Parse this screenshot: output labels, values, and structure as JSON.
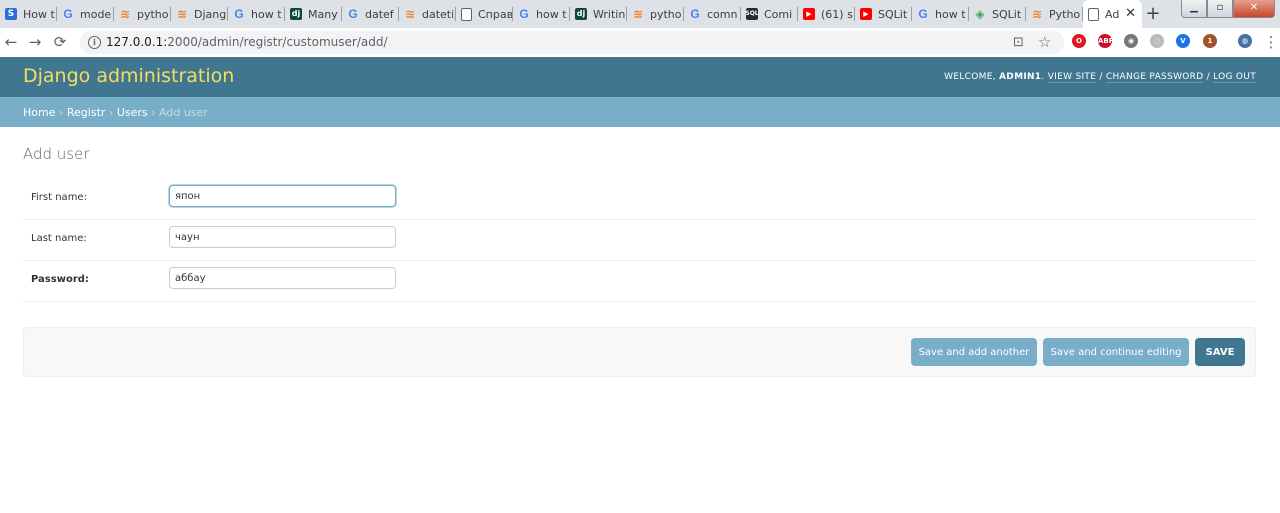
{
  "browser": {
    "tabs": [
      {
        "favicon": "S",
        "kind": "fav-s",
        "label": "How t"
      },
      {
        "favicon": "G",
        "kind": "fav-g",
        "label": "mode"
      },
      {
        "favicon": "≋",
        "kind": "fav-so",
        "label": "pytho"
      },
      {
        "favicon": "≋",
        "kind": "fav-so",
        "label": "Djang"
      },
      {
        "favicon": "G",
        "kind": "fav-g",
        "label": "how t"
      },
      {
        "favicon": "dj",
        "kind": "fav-dj",
        "label": "Many"
      },
      {
        "favicon": "G",
        "kind": "fav-g",
        "label": "datef"
      },
      {
        "favicon": "≋",
        "kind": "fav-so",
        "label": "dateti"
      },
      {
        "favicon": "",
        "kind": "fav-doc",
        "label": "Справ"
      },
      {
        "favicon": "G",
        "kind": "fav-g",
        "label": "how t"
      },
      {
        "favicon": "dj",
        "kind": "fav-dj",
        "label": "Writin"
      },
      {
        "favicon": "≋",
        "kind": "fav-so",
        "label": "pytho"
      },
      {
        "favicon": "G",
        "kind": "fav-g",
        "label": "comn"
      },
      {
        "favicon": "SQL",
        "kind": "fav-sql",
        "label": "Comi"
      },
      {
        "favicon": "▶",
        "kind": "fav-yt",
        "label": "(61) s"
      },
      {
        "favicon": "▶",
        "kind": "fav-yt",
        "label": "SQLit"
      },
      {
        "favicon": "G",
        "kind": "fav-g",
        "label": "how t"
      },
      {
        "favicon": "◈",
        "kind": "fav-sqlc",
        "label": "SQLit"
      },
      {
        "favicon": "≋",
        "kind": "fav-so",
        "label": "Pytho"
      }
    ],
    "active_tab": {
      "label": "Ad",
      "close": "✕"
    },
    "new_tab": "+",
    "window_controls": {
      "minimize": "▁",
      "maximize": "▫",
      "close": "✕"
    },
    "nav": {
      "back": "←",
      "forward": "→",
      "reload": "⟳"
    },
    "url": {
      "host": "127.0.0.1:",
      "rest": "2000/admin/registr/customuser/add/"
    },
    "omnibox_icons": {
      "translate": "⊡",
      "star": "☆"
    },
    "extensions": [
      {
        "glyph": "O",
        "color": "#e0191f"
      },
      {
        "glyph": "ABP",
        "color": "#c70d2c"
      },
      {
        "glyph": "◉",
        "color": "#777777"
      },
      {
        "glyph": "◌",
        "color": "#bbbbbb"
      },
      {
        "glyph": "V",
        "color": "#1a73e8"
      },
      {
        "glyph": "1",
        "color": "#a0522d"
      },
      {
        "glyph": "◍",
        "color": "#4a6fa5"
      }
    ],
    "menu": "⋮"
  },
  "header": {
    "branding": "Django administration",
    "welcome": "Welcome,",
    "username": "admin1",
    "view_site": "View site",
    "change_password": "Change password",
    "logout": "Log out",
    "separator": " / "
  },
  "breadcrumbs": {
    "home": "Home",
    "app": "Registr",
    "model": "Users",
    "current": "Add user",
    "sep": " › "
  },
  "page": {
    "title": "Add user",
    "fields": {
      "first_name": {
        "label": "First name:",
        "value": "япон"
      },
      "last_name": {
        "label": "Last name:",
        "value": "чаун"
      },
      "password": {
        "label": "Password:",
        "value": "аббау"
      }
    },
    "buttons": {
      "save_add_another": "Save and add another",
      "save_continue": "Save and continue editing",
      "save": "SAVE"
    }
  }
}
